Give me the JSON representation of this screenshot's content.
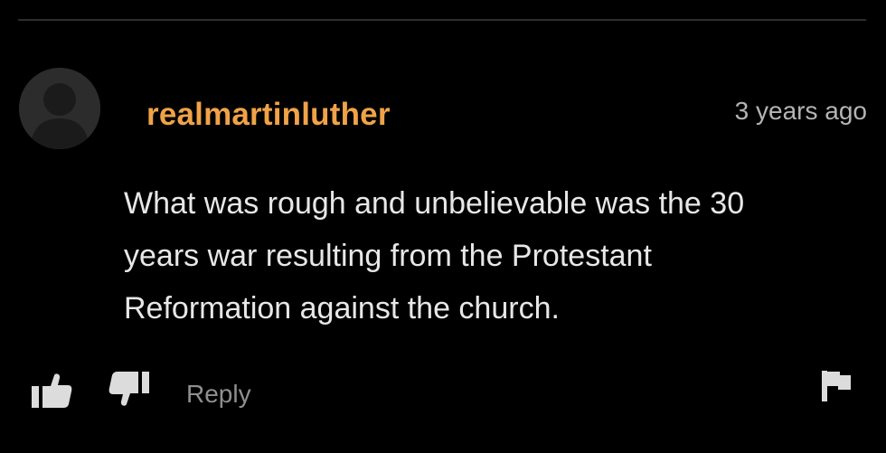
{
  "comment": {
    "username": "realmartinluther",
    "timestamp": "3 years ago",
    "body_lines": [
      "What was rough and unbelievable was the 30",
      "years war resulting from the Protestant",
      "Reformation against the church."
    ]
  },
  "actions": {
    "like_icon": "thumbs-up-icon",
    "dislike_icon": "thumbs-down-icon",
    "reply_label": "Reply",
    "flag_icon": "flag-icon"
  },
  "colors": {
    "background": "#000000",
    "username": "#f0a248",
    "body_text": "#e7e7e7",
    "timestamp": "#b4b4b4",
    "action_gray": "#8f8f8f",
    "icon": "#dcdcdc"
  }
}
